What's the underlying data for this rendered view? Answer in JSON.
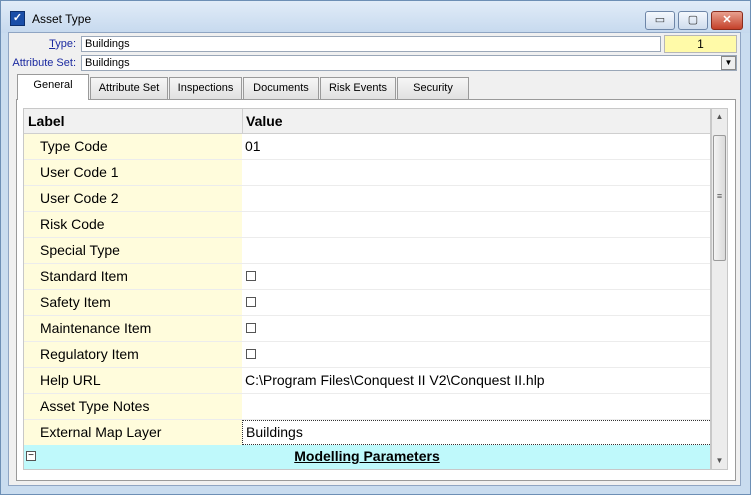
{
  "window": {
    "title": "Asset Type",
    "buttons": {
      "minimize": "▭",
      "maximize": "▢",
      "close": "✕"
    }
  },
  "header": {
    "type_label_prefix": "",
    "type_label_key": "T",
    "type_label_rest": "ype:",
    "type_value": "Buildings",
    "id_value": "1",
    "attribute_set_label": "Attribute Set:",
    "attribute_set_value": "Buildings"
  },
  "tabs": [
    {
      "label": "General",
      "active": true
    },
    {
      "label": "Attribute Set",
      "active": false
    },
    {
      "label": "Inspections",
      "active": false
    },
    {
      "label": "Documents",
      "active": false
    },
    {
      "label": "Risk Events",
      "active": false
    },
    {
      "label": "Security",
      "active": false
    }
  ],
  "grid": {
    "columns": {
      "label": "Label",
      "value": "Value"
    },
    "rows": [
      {
        "label": "Type Code",
        "value": "01"
      },
      {
        "label": "User Code 1",
        "value": ""
      },
      {
        "label": "User Code 2",
        "value": ""
      },
      {
        "label": "Risk Code",
        "value": ""
      },
      {
        "label": "Special Type",
        "value": ""
      },
      {
        "label": "Standard Item",
        "value": "",
        "checkbox": true
      },
      {
        "label": "Safety Item",
        "value": "",
        "checkbox": true
      },
      {
        "label": "Maintenance Item",
        "value": "",
        "checkbox": true
      },
      {
        "label": "Regulatory Item",
        "value": "",
        "checkbox": true
      },
      {
        "label": "Help URL",
        "value": "C:\\Program Files\\Conquest II V2\\Conquest II.hlp"
      },
      {
        "label": "Asset Type Notes",
        "value": ""
      },
      {
        "label": "External Map Layer",
        "value": "Buildings"
      }
    ],
    "section": {
      "title": "Modelling Parameters",
      "toggle": "−"
    }
  },
  "colors": {
    "label_cell_bg": "#fffcdc",
    "section_bg": "#bff9fb",
    "id_box_bg": "#fffaa8",
    "field_label": "#1b2aa0"
  }
}
